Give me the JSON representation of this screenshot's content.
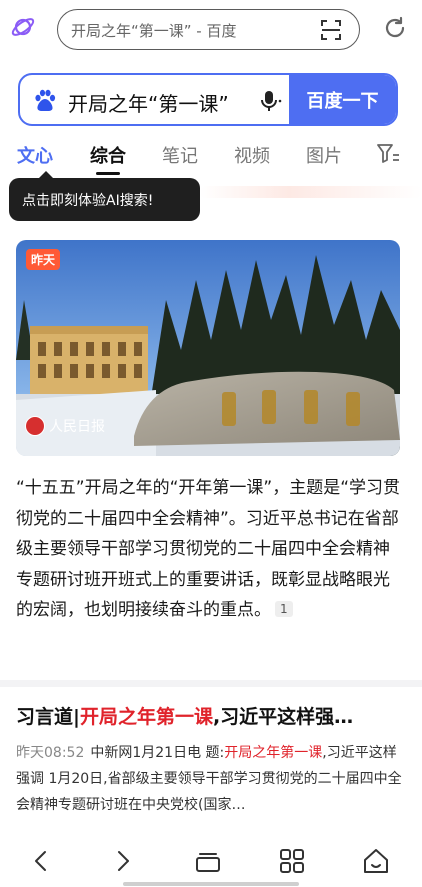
{
  "browser": {
    "url_text": "开局之年“第一课” - 百度",
    "icons": {
      "logo": "planet-icon",
      "scan": "scan-icon",
      "reload": "reload-icon"
    }
  },
  "search": {
    "query": "开局之年“第一课”",
    "button_label": "百度一下",
    "icons": {
      "logo": "baidu-paw-icon",
      "voice": "microphone-icon"
    }
  },
  "tabs": [
    {
      "label": "文心"
    },
    {
      "label": "综合"
    },
    {
      "label": "笔记"
    },
    {
      "label": "视频"
    },
    {
      "label": "图片"
    }
  ],
  "tooltip": {
    "text": "点击即刻体验AI搜索!"
  },
  "image_card": {
    "badge": "昨天",
    "source": "人民日报"
  },
  "summary": {
    "text": "“十五五”开局之年的“开年第一课”，主题是“学习贯彻党的二十届四中全会精神”。习近平总书记在省部级主要领导干部学习贯彻党的二十届四中全会精神专题研讨班开班式上的重要讲话，既彰显战略眼光的宏阔，也划明接续奋斗的重点。",
    "citation": "1"
  },
  "result": {
    "title_prefix": "习言道|",
    "title_highlight": "开局之年第一课",
    "title_suffix": ",习近平这样强…",
    "time": "昨天08:52",
    "snippet_pre": "中新网1月21日电 题:",
    "snippet_highlight": "开局之年第一课",
    "snippet_post": ",习近平这样强调 1月20日,省部级主要领导干部学习贯彻党的二十届四中全会精神专题研讨班在中央党校(国家…"
  },
  "bottom_nav": [
    {
      "icon": "back-icon"
    },
    {
      "icon": "forward-icon"
    },
    {
      "icon": "tabs-icon"
    },
    {
      "icon": "apps-grid-icon"
    },
    {
      "icon": "home-icon"
    }
  ],
  "colors": {
    "accent": "#4e6ef2",
    "highlight": "#e0232b",
    "badge": "#ff5a36"
  }
}
